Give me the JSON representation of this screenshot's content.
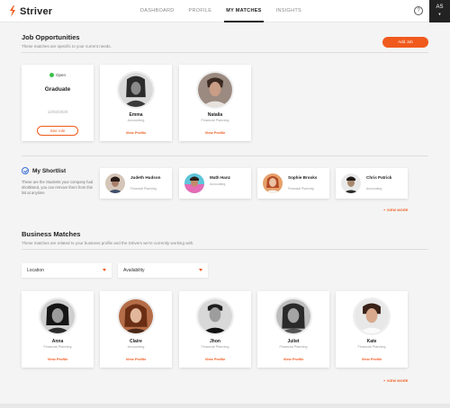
{
  "brand": {
    "name": "Striver",
    "accent": "#f05a1d"
  },
  "nav": {
    "items": [
      "DASHBOARD",
      "PROFILE",
      "MY MATCHES",
      "INSIGHTS"
    ],
    "active": "MY MATCHES"
  },
  "header": {
    "help_icon": "question-icon",
    "user_initials": "AS"
  },
  "jobs": {
    "title": "Job Opportunities",
    "subtitle": "These matches are specific to your current needs.",
    "add_label": "Add Job",
    "job_card": {
      "status": "Open",
      "title": "Graduate",
      "date": "12/02/2020",
      "button": "See role"
    },
    "people": [
      {
        "name": "Emma",
        "role": "Accounting",
        "link": "View Profile"
      },
      {
        "name": "Natalia",
        "role": "Financial Planning",
        "link": "View Profile"
      }
    ]
  },
  "shortlist": {
    "title": "My Shortlist",
    "description": "These are the Students your company had shortlisted, you can remove them from this list at anytime",
    "people": [
      {
        "name": "Judeth Hudson",
        "role": "Financial Planning"
      },
      {
        "name": "Math Hanz",
        "role": "Accounting"
      },
      {
        "name": "Sophie Brooks",
        "role": "Financial Planning"
      },
      {
        "name": "Chris Patrick",
        "role": "Accounting"
      }
    ],
    "view_more": "+ VIEW MORE"
  },
  "business": {
    "title": "Business Matches",
    "subtitle": "These matches are related to your business profile and the Strivers we're currently working with.",
    "filters": [
      {
        "label": "Location"
      },
      {
        "label": "Availability"
      }
    ],
    "people": [
      {
        "name": "Anna",
        "role": "Financial Planning",
        "link": "View Profile"
      },
      {
        "name": "Claire",
        "role": "Accounting",
        "link": "View Profile"
      },
      {
        "name": "Jhon",
        "role": "Financial Planning",
        "link": "View Profile"
      },
      {
        "name": "Juliet",
        "role": "Financial Planning",
        "link": "View Profile"
      },
      {
        "name": "Kate",
        "role": "Financial Planning",
        "link": "View Profile"
      }
    ],
    "view_more": "+ VIEW MORE"
  }
}
